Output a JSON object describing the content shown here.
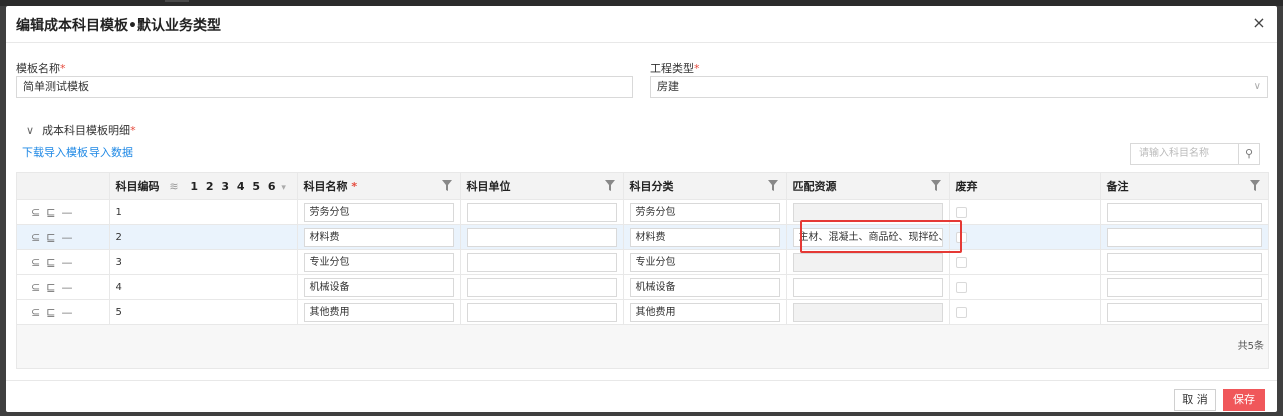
{
  "modal": {
    "title": "编辑成本科目模板•默认业务类型",
    "close": "×"
  },
  "form": {
    "template_name_label": "模板名称",
    "template_name_value": "简单测试模板",
    "project_type_label": "工程类型",
    "project_type_value": "房建",
    "required_mark": "*"
  },
  "section": {
    "toggle_label": "成本科目模板明细",
    "download_link": "下载导入模板",
    "import_link": "导入数据",
    "search_placeholder": "请输入科目名称"
  },
  "table": {
    "columns": {
      "code": "科目编码",
      "levels": "1 2 3 4 5 6",
      "name": "科目名称",
      "unit": "科目单位",
      "category": "科目分类",
      "resource": "匹配资源",
      "discard": "废弃",
      "remark": "备注"
    },
    "rows": [
      {
        "code": "1",
        "name": "劳务分包",
        "unit": "",
        "category": "劳务分包",
        "resource": "",
        "resource_disabled": true
      },
      {
        "code": "2",
        "name": "材料费",
        "unit": "",
        "category": "材料费",
        "resource": "主材、混凝土、商品砼、现拌砼、",
        "resource_disabled": false
      },
      {
        "code": "3",
        "name": "专业分包",
        "unit": "",
        "category": "专业分包",
        "resource": "",
        "resource_disabled": true
      },
      {
        "code": "4",
        "name": "机械设备",
        "unit": "",
        "category": "机械设备",
        "resource": "",
        "resource_disabled": false
      },
      {
        "code": "5",
        "name": "其他费用",
        "unit": "",
        "category": "其他费用",
        "resource": "",
        "resource_disabled": true
      }
    ],
    "selected_row_index": 1,
    "total": "共5条"
  },
  "footer": {
    "cancel": "取 消",
    "save": "保存"
  },
  "colors": {
    "accent_link": "#1e88e5",
    "save_button": "#f0575a",
    "highlight": "#e53935",
    "required": "#e64a3c"
  }
}
